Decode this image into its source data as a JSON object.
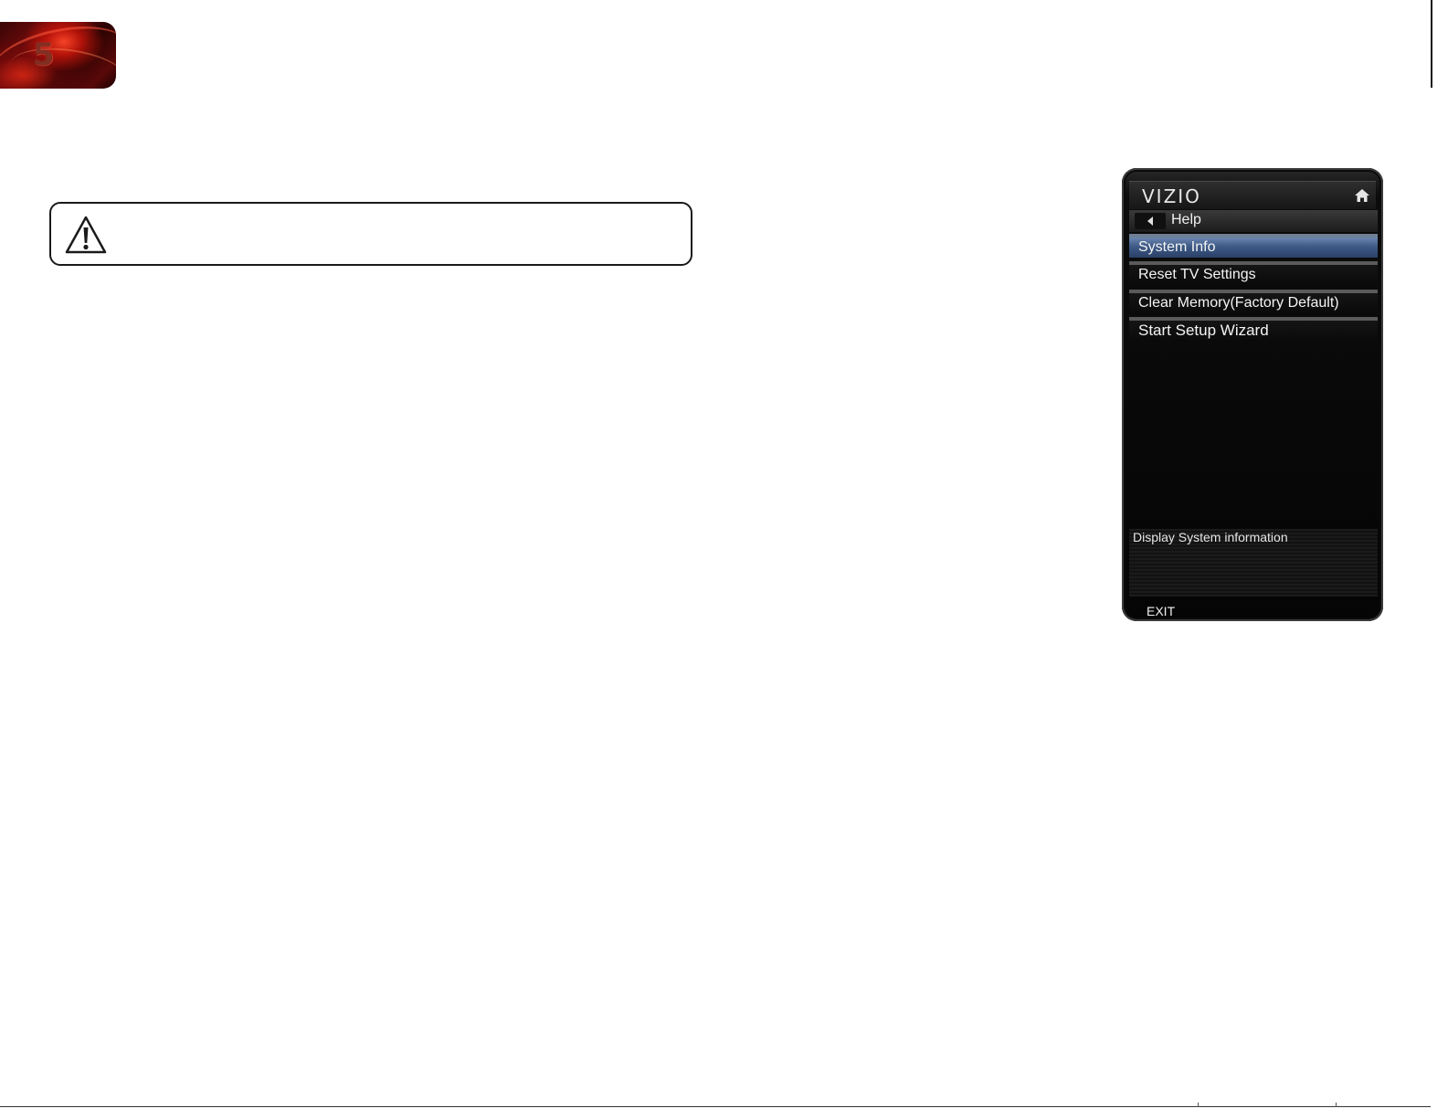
{
  "chapter": {
    "number": "5"
  },
  "tv_menu": {
    "brand": "VIZIO",
    "back_label": "Help",
    "items": [
      {
        "label": "System Info",
        "selected": true
      },
      {
        "label": "Reset TV Settings",
        "selected": false
      },
      {
        "label": "Clear Memory(Factory Default)",
        "selected": false
      },
      {
        "label": "Start Setup Wizard",
        "selected": false
      }
    ],
    "description": "Display System information",
    "exit_label": "EXIT",
    "highlight_color": "#3e5a86"
  },
  "icons": {
    "caution": "warning-triangle-icon",
    "home": "home-icon",
    "back": "back-arrow-icon"
  }
}
